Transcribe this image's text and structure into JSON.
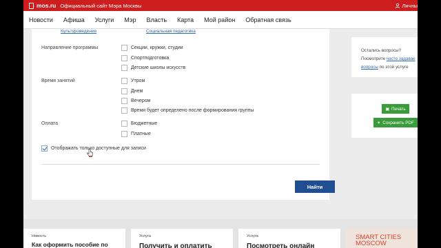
{
  "header": {
    "site_name": "mos.ru",
    "tagline": "Официальный сайт Мэра Москвы",
    "user_label": "Личны"
  },
  "nav": {
    "items": [
      "Новости",
      "Афиша",
      "Услуги",
      "Мэр",
      "Власть",
      "Карта",
      "Мой район",
      "Обратная связь"
    ]
  },
  "filters": {
    "prev_links": [
      "Культуроведение",
      "Социальная педагогика"
    ],
    "program_direction": {
      "label": "Направление программы",
      "options": [
        "Секции, кружки, студии",
        "Спортподготовка",
        "Детские школы искусств"
      ]
    },
    "time": {
      "label": "Время занятий",
      "options": [
        "Утром",
        "Днем",
        "Вечером",
        "Время будет определено после формирования группы"
      ]
    },
    "payment": {
      "label": "Оплата",
      "options": [
        "Бюджетные",
        "Платные"
      ]
    },
    "available_only": {
      "label": "Отображать только доступные для записи",
      "checked": true
    },
    "find_button": "Найти"
  },
  "sidebar": {
    "help_text_1": "Остались вопросы?",
    "help_text_2": "Посмотрите",
    "help_link_1": "часто задавае",
    "help_link_2": "вопросы",
    "help_text_3": "по этой услуге",
    "print_button": "Печать",
    "save_pdf_button": "Сохранить PDF"
  },
  "bottom_cards": [
    {
      "kicker": "Новость",
      "headline": "Как оформить пособие по"
    },
    {
      "kicker": "Услуга",
      "headline": "Получить и оплатить"
    },
    {
      "kicker": "Услуга",
      "headline": "Посмотреть онлайн"
    },
    {
      "title_line1": "SMART CITIES",
      "title_line2": "MOSCOW"
    }
  ],
  "colors": {
    "brand_red": "#cc1e1e",
    "primary_blue": "#214d91",
    "action_green": "#3a9b3a",
    "link_blue": "#2d6ab0"
  }
}
